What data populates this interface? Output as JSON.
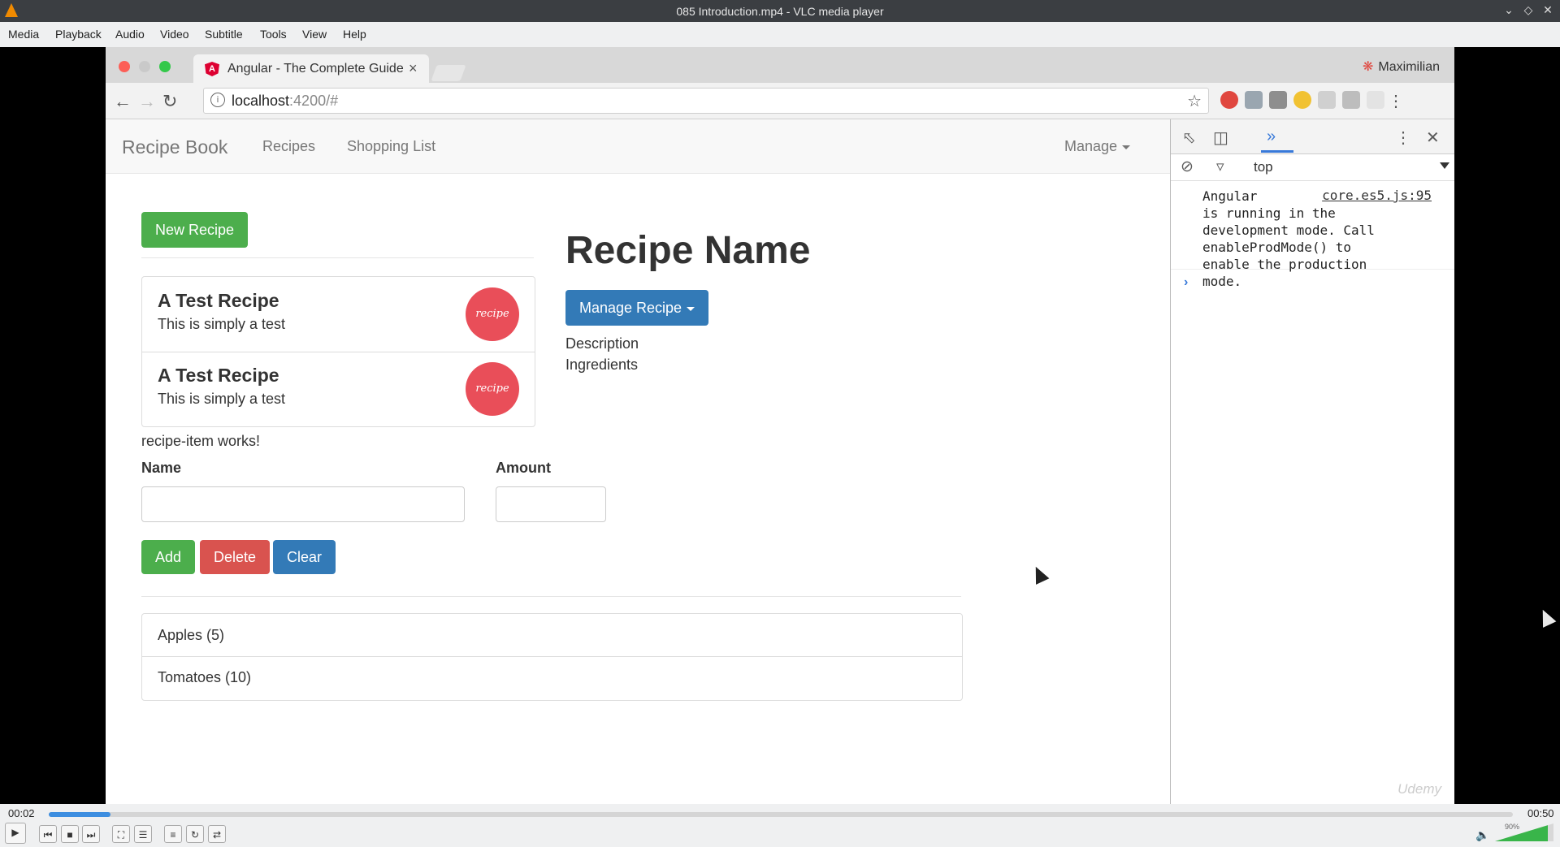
{
  "vlc": {
    "window_title": "085 Introduction.mp4 - VLC media player",
    "menu": [
      "Media",
      "Playback",
      "Audio",
      "Video",
      "Subtitle",
      "Tools",
      "View",
      "Help"
    ],
    "time_elapsed": "00:02",
    "time_total": "00:50",
    "progress_fraction": 0.042,
    "volume_text": "90%",
    "volume_fraction": 0.9
  },
  "browser": {
    "tab_title": "Angular - The Complete Guide",
    "profile_name": "Maximilian",
    "url_host": "localhost",
    "url_path": ":4200/#"
  },
  "app": {
    "brand": "Recipe Book",
    "nav": {
      "recipes": "Recipes",
      "shopping_list": "Shopping List",
      "manage": "Manage"
    },
    "new_recipe_button": "New Recipe",
    "recipes": [
      {
        "name": "A Test Recipe",
        "description": "This is simply a test",
        "image_text": "recipe"
      },
      {
        "name": "A Test Recipe",
        "description": "This is simply a test",
        "image_text": "recipe"
      }
    ],
    "recipe_item_works": "recipe-item works!",
    "detail": {
      "title": "Recipe Name",
      "manage_button": "Manage Recipe",
      "description": "Description",
      "ingredients": "Ingredients"
    },
    "shopping_edit": {
      "name_label": "Name",
      "amount_label": "Amount",
      "add_button": "Add",
      "delete_button": "Delete",
      "clear_button": "Clear"
    },
    "shopping_list": [
      "Apples (5)",
      "Tomatoes (10)"
    ],
    "watermark": "Udemy"
  },
  "devtools": {
    "context": "top",
    "console_message": "Angular\nis running in the\ndevelopment mode. Call\nenableProdMode() to\nenable the production\nmode.",
    "console_source": "core.es5.js:95"
  },
  "colors": {
    "success": "#4cae4c",
    "danger": "#d9534f",
    "primary": "#337ab7",
    "vlc_progress": "#3d8ee0"
  }
}
